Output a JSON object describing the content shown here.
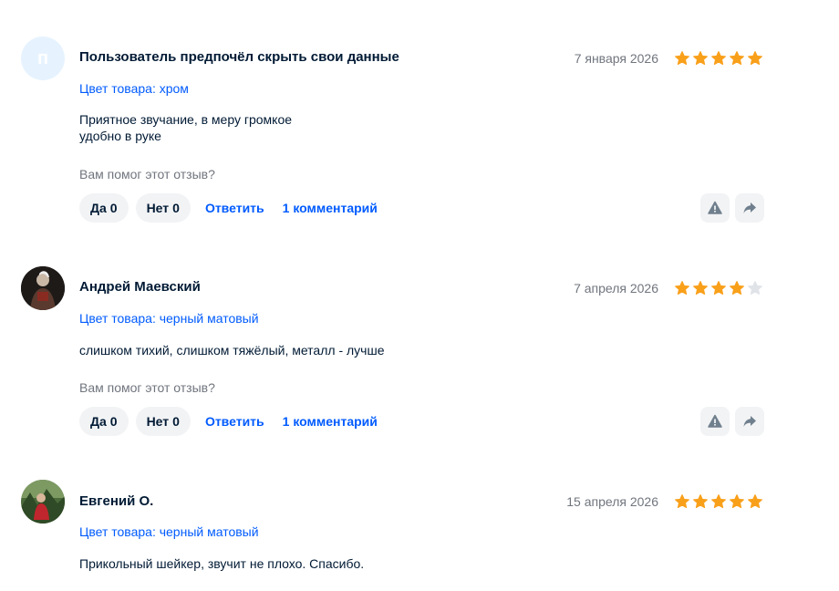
{
  "colors": {
    "accent": "#005bff",
    "star_filled": "#f9a01b",
    "star_empty": "#e0e3e8",
    "muted": "#70757e"
  },
  "reviews": [
    {
      "avatar_letter": "п",
      "author": "Пользователь предпочёл скрыть свои данные",
      "date": "7 января 2026",
      "rating": 5,
      "variant": "Цвет товара: хром",
      "text": "Приятное звучание, в меру громкое\nудобно в руке",
      "helpful_question": "Вам помог этот отзыв?",
      "yes_label": "Да",
      "yes_count": "0",
      "no_label": "Нет",
      "no_count": "0",
      "reply_label": "Ответить",
      "comments_label": "1 комментарий"
    },
    {
      "author": "Андрей Маевский",
      "date": "7 апреля 2026",
      "rating": 4,
      "variant": "Цвет товара: черный матовый",
      "text": "слишком тихий, слишком тяжёлый, металл - лучше",
      "helpful_question": "Вам помог этот отзыв?",
      "yes_label": "Да",
      "yes_count": "0",
      "no_label": "Нет",
      "no_count": "0",
      "reply_label": "Ответить",
      "comments_label": "1 комментарий"
    },
    {
      "author": "Евгений О.",
      "date": "15 апреля 2026",
      "rating": 5,
      "variant": "Цвет товара: черный матовый",
      "text": "Прикольный шейкер, звучит не плохо. Спасибо."
    }
  ]
}
